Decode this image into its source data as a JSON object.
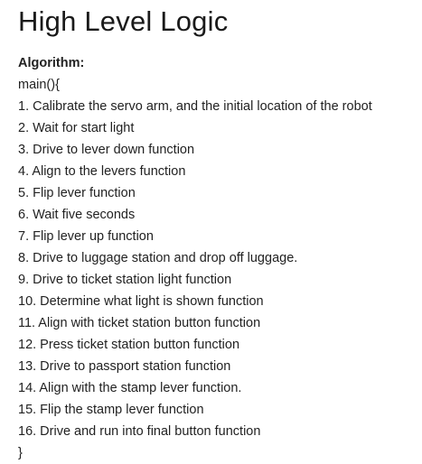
{
  "title": "High Level Logic",
  "section_heading": "Algorithm:",
  "code_open": "main(){",
  "steps": [
    "1. Calibrate the servo arm, and the initial location of the robot",
    "2. Wait for start light",
    "3. Drive to lever down function",
    "4. Align to the levers function",
    "5. Flip lever function",
    "6. Wait five seconds",
    "7. Flip lever up function",
    "8. Drive to luggage station and drop off luggage.",
    "9. Drive to ticket station light function",
    "10. Determine what light is shown function",
    "11. Align with ticket station button function",
    "12. Press ticket station button function",
    "13. Drive to passport station function",
    "14. Align with the stamp lever function.",
    "15. Flip the stamp lever function",
    "16. Drive and run into final button function"
  ],
  "code_close": "}"
}
